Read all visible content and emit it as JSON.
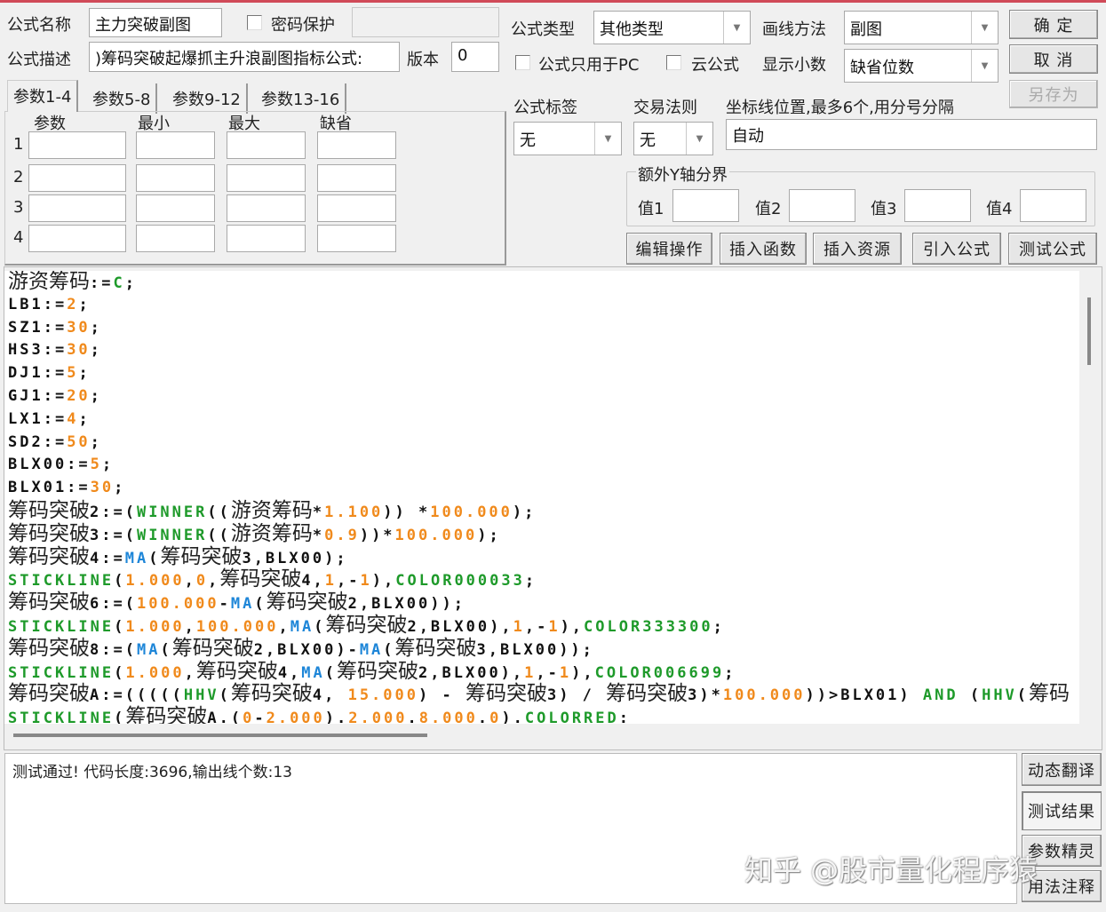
{
  "form": {
    "name_label": "公式名称",
    "name_value": "主力突破副图",
    "password_label": "密码保护",
    "desc_label": "公式描述",
    "desc_value": ")筹码突破起爆抓主升浪副图指标公式:",
    "version_label": "版本",
    "version_value": "0",
    "type_label": "公式类型",
    "type_value": "其他类型",
    "draw_label": "画线方法",
    "draw_value": "副图",
    "pc_only_label": "公式只用于PC",
    "cloud_label": "云公式",
    "decimals_label": "显示小数",
    "decimals_value": "缺省位数",
    "tag_label": "公式标签",
    "tag_value": "无",
    "trade_label": "交易法则",
    "trade_value": "无",
    "axis_label": "坐标线位置,最多6个,用分号分隔",
    "axis_value": "自动",
    "yaxis_group": "额外Y轴分界",
    "yvals": [
      "值1",
      "值2",
      "值3",
      "值4"
    ]
  },
  "buttons": {
    "ok": "确 定",
    "cancel": "取 消",
    "saveas": "另存为",
    "edit": "编辑操作",
    "insert_func": "插入函数",
    "insert_res": "插入资源",
    "import": "引入公式",
    "test": "测试公式",
    "translate": "动态翻译",
    "result": "测试结果",
    "wizard": "参数精灵",
    "usage": "用法注释"
  },
  "tabs": [
    "参数1-4",
    "参数5-8",
    "参数9-12",
    "参数13-16"
  ],
  "params": {
    "headers": [
      "参数",
      "最小",
      "最大",
      "缺省"
    ],
    "rows": [
      "1",
      "2",
      "3",
      "4"
    ]
  },
  "code_lines": [
    [
      [
        "c",
        "游资筹码"
      ],
      [
        "k",
        ":="
      ],
      [
        "g",
        "C"
      ],
      [
        "k",
        ";"
      ]
    ],
    [
      [
        "k",
        "LB1:="
      ],
      [
        "o",
        "2"
      ],
      [
        "k",
        ";"
      ]
    ],
    [
      [
        "k",
        "SZ1:="
      ],
      [
        "o",
        "30"
      ],
      [
        "k",
        ";"
      ]
    ],
    [
      [
        "k",
        "HS3:="
      ],
      [
        "o",
        "30"
      ],
      [
        "k",
        ";"
      ]
    ],
    [
      [
        "k",
        "DJ1:="
      ],
      [
        "o",
        "5"
      ],
      [
        "k",
        ";"
      ]
    ],
    [
      [
        "k",
        "GJ1:="
      ],
      [
        "o",
        "20"
      ],
      [
        "k",
        ";"
      ]
    ],
    [
      [
        "k",
        "LX1:="
      ],
      [
        "o",
        "4"
      ],
      [
        "k",
        ";"
      ]
    ],
    [
      [
        "k",
        "SD2:="
      ],
      [
        "o",
        "50"
      ],
      [
        "k",
        ";"
      ]
    ],
    [
      [
        "k",
        "BLX00:="
      ],
      [
        "o",
        "5"
      ],
      [
        "k",
        ";"
      ]
    ],
    [
      [
        "k",
        "BLX01:="
      ],
      [
        "o",
        "30"
      ],
      [
        "k",
        ";"
      ]
    ],
    [
      [
        "c",
        "筹码突破"
      ],
      [
        "k",
        "2:=("
      ],
      [
        "g",
        "WINNER"
      ],
      [
        "k",
        "(("
      ],
      [
        "c",
        "游资筹码"
      ],
      [
        "k",
        "*"
      ],
      [
        "o",
        "1.100"
      ],
      [
        "k",
        ")) *"
      ],
      [
        "o",
        "100.000"
      ],
      [
        "k",
        ");"
      ]
    ],
    [
      [
        "c",
        "筹码突破"
      ],
      [
        "k",
        "3:=("
      ],
      [
        "g",
        "WINNER"
      ],
      [
        "k",
        "(("
      ],
      [
        "c",
        "游资筹码"
      ],
      [
        "k",
        "*"
      ],
      [
        "o",
        "0.9"
      ],
      [
        "k",
        "))*"
      ],
      [
        "o",
        "100.000"
      ],
      [
        "k",
        ");"
      ]
    ],
    [
      [
        "c",
        "筹码突破"
      ],
      [
        "k",
        "4:="
      ],
      [
        "b",
        "MA"
      ],
      [
        "k",
        "("
      ],
      [
        "c",
        "筹码突破"
      ],
      [
        "k",
        "3,BLX00);"
      ]
    ],
    [
      [
        "g",
        "STICKLINE"
      ],
      [
        "k",
        "("
      ],
      [
        "o",
        "1.000"
      ],
      [
        "k",
        ","
      ],
      [
        "o",
        "0"
      ],
      [
        "k",
        ","
      ],
      [
        "c",
        "筹码突破"
      ],
      [
        "k",
        "4,"
      ],
      [
        "o",
        "1"
      ],
      [
        "k",
        ",-"
      ],
      [
        "o",
        "1"
      ],
      [
        "k",
        "),"
      ],
      [
        "g",
        "COLOR000033"
      ],
      [
        "k",
        ";"
      ]
    ],
    [
      [
        "c",
        "筹码突破"
      ],
      [
        "k",
        "6:=("
      ],
      [
        "o",
        "100.000"
      ],
      [
        "k",
        "-"
      ],
      [
        "b",
        "MA"
      ],
      [
        "k",
        "("
      ],
      [
        "c",
        "筹码突破"
      ],
      [
        "k",
        "2,BLX00));"
      ]
    ],
    [
      [
        "g",
        "STICKLINE"
      ],
      [
        "k",
        "("
      ],
      [
        "o",
        "1.000"
      ],
      [
        "k",
        ","
      ],
      [
        "o",
        "100.000"
      ],
      [
        "k",
        ","
      ],
      [
        "b",
        "MA"
      ],
      [
        "k",
        "("
      ],
      [
        "c",
        "筹码突破"
      ],
      [
        "k",
        "2,BLX00),"
      ],
      [
        "o",
        "1"
      ],
      [
        "k",
        ",-"
      ],
      [
        "o",
        "1"
      ],
      [
        "k",
        "),"
      ],
      [
        "g",
        "COLOR333300"
      ],
      [
        "k",
        ";"
      ]
    ],
    [
      [
        "c",
        "筹码突破"
      ],
      [
        "k",
        "8:=("
      ],
      [
        "b",
        "MA"
      ],
      [
        "k",
        "("
      ],
      [
        "c",
        "筹码突破"
      ],
      [
        "k",
        "2,BLX00)-"
      ],
      [
        "b",
        "MA"
      ],
      [
        "k",
        "("
      ],
      [
        "c",
        "筹码突破"
      ],
      [
        "k",
        "3,BLX00));"
      ]
    ],
    [
      [
        "g",
        "STICKLINE"
      ],
      [
        "k",
        "("
      ],
      [
        "o",
        "1.000"
      ],
      [
        "k",
        ","
      ],
      [
        "c",
        "筹码突破"
      ],
      [
        "k",
        "4,"
      ],
      [
        "b",
        "MA"
      ],
      [
        "k",
        "("
      ],
      [
        "c",
        "筹码突破"
      ],
      [
        "k",
        "2,BLX00),"
      ],
      [
        "o",
        "1"
      ],
      [
        "k",
        ",-"
      ],
      [
        "o",
        "1"
      ],
      [
        "k",
        "),"
      ],
      [
        "g",
        "COLOR006699"
      ],
      [
        "k",
        ";"
      ]
    ],
    [
      [
        "c",
        "筹码突破"
      ],
      [
        "k",
        "A:=((((("
      ],
      [
        "g",
        "HHV"
      ],
      [
        "k",
        "("
      ],
      [
        "c",
        "筹码突破"
      ],
      [
        "k",
        "4, "
      ],
      [
        "o",
        "15.000"
      ],
      [
        "k",
        ") - "
      ],
      [
        "c",
        "筹码突破"
      ],
      [
        "k",
        "3) / "
      ],
      [
        "c",
        "筹码突破"
      ],
      [
        "k",
        "3)*"
      ],
      [
        "o",
        "100.000"
      ],
      [
        "k",
        "))>BLX01) "
      ],
      [
        "g",
        "AND"
      ],
      [
        "k",
        " ("
      ],
      [
        "g",
        "HHV"
      ],
      [
        "k",
        "("
      ],
      [
        "c",
        "筹码"
      ]
    ],
    [
      [
        "g",
        "STICKLINE"
      ],
      [
        "k",
        "("
      ],
      [
        "c",
        "筹码突破"
      ],
      [
        "k",
        "A.("
      ],
      [
        "o",
        "0"
      ],
      [
        "k",
        "-"
      ],
      [
        "o",
        "2.000"
      ],
      [
        "k",
        ")."
      ],
      [
        "o",
        "2.000"
      ],
      [
        "k",
        "."
      ],
      [
        "o",
        "8.000"
      ],
      [
        "k",
        "."
      ],
      [
        "o",
        "0"
      ],
      [
        "k",
        ")."
      ],
      [
        "g",
        "COLORRED"
      ],
      [
        "k",
        ":"
      ]
    ]
  ],
  "output": "测试通过! 代码长度:3696,输出线个数:13",
  "watermark": "知乎 @股市量化程序猿",
  "colors": {
    "green": "#1e9a2a",
    "orange": "#f08a1c",
    "blue": "#1e86d8"
  }
}
